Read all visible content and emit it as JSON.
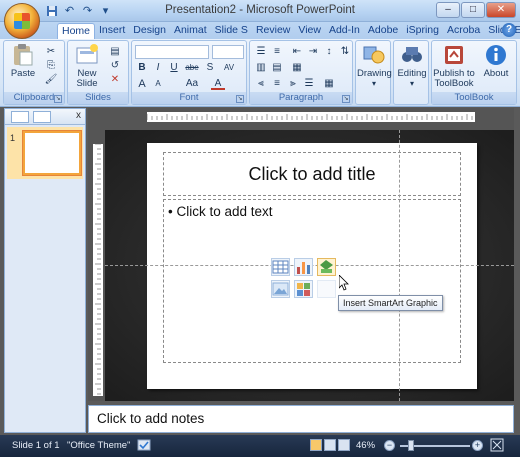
{
  "window": {
    "title": "Presentation2 - Microsoft PowerPoint",
    "controls": {
      "minimize": "–",
      "maximize": "□",
      "close": "✕"
    }
  },
  "quick_access": [
    "save-icon",
    "undo-icon",
    "redo-icon",
    "customize-icon"
  ],
  "tabs": [
    "Home",
    "Insert",
    "Design",
    "Animat",
    "Slide S",
    "Review",
    "View",
    "Add-In",
    "Adobe",
    "iSpring",
    "Acroba",
    "Slide E"
  ],
  "active_tab": "Home",
  "help_label": "?",
  "ribbon": {
    "clipboard": {
      "label": "Clipboard",
      "paste": "Paste"
    },
    "slides": {
      "label": "Slides",
      "new_slide": "New Slide"
    },
    "font": {
      "label": "Font",
      "bold": "B",
      "italic": "I",
      "underline": "U",
      "strike": "abe",
      "shadow": "S",
      "spacing": "AV",
      "grow": "A",
      "shrink": "A",
      "aa": "Aa",
      "color": "A"
    },
    "paragraph": {
      "label": "Paragraph"
    },
    "drawing": {
      "label": "Drawing"
    },
    "editing": {
      "label": "Editing"
    },
    "publish": {
      "label": "Publish to ToolBook"
    },
    "about": {
      "label": "About"
    },
    "toolbook_group": {
      "label": "ToolBook"
    }
  },
  "panel": {
    "slide_number": "1",
    "close": "x"
  },
  "slide": {
    "title_placeholder": "Click to add title",
    "body_placeholder": "Click to add text",
    "bullet": "•"
  },
  "tooltip": "Insert SmartArt Graphic",
  "notes_placeholder": "Click to add notes",
  "status": {
    "slide_info": "Slide 1 of 1",
    "theme": "\"Office Theme\"",
    "zoom": "46%",
    "zoom_out": "−",
    "zoom_in": "+"
  },
  "colors": {
    "accent": "#f3a53b",
    "ribbon_bg": "#d6e5f6",
    "statusbar_bg": "#1e2f48"
  }
}
